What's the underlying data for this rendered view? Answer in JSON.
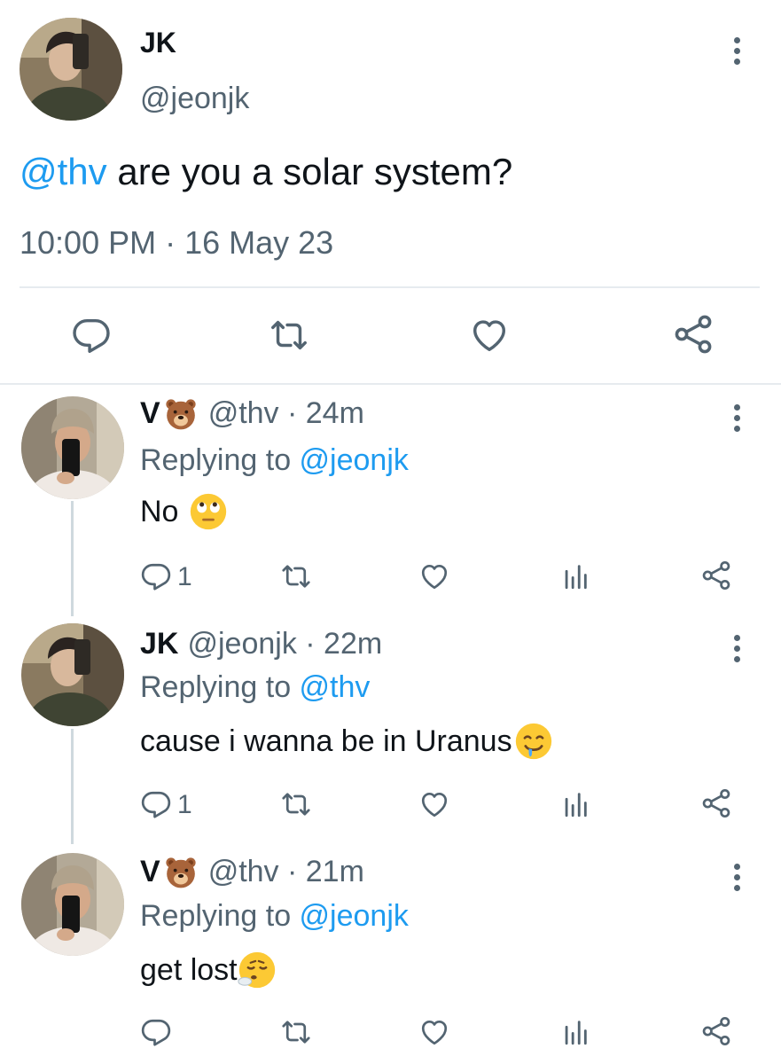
{
  "main_tweet": {
    "name": "JK",
    "handle": "@jeonjk",
    "mention": "@thv",
    "text": " are you a solar system?",
    "time": "10:00 PM · 16 May 23"
  },
  "replies": [
    {
      "name": "V",
      "name_emoji": "bear-face-emoji",
      "handle_time": "@thv · 24m",
      "replying_prefix": "Replying to ",
      "replying_to": "@jeonjk",
      "text": "No",
      "text_emoji": "face-with-rolling-eyes-emoji",
      "reply_count": "1"
    },
    {
      "name": "JK",
      "handle_time": "@jeonjk · 22m",
      "replying_prefix": "Replying to ",
      "replying_to": "@thv",
      "text": "cause i wanna be in Uranus",
      "text_emoji": "drooling-face-emoji",
      "reply_count": "1"
    },
    {
      "name": "V",
      "name_emoji": "bear-face-emoji",
      "handle_time": "@thv · 21m",
      "replying_prefix": "Replying to ",
      "replying_to": "@jeonjk",
      "text": "get lost",
      "text_emoji": "face-exhaling-emoji",
      "reply_count": ""
    }
  ],
  "colors": {
    "accent": "#1d9bf0",
    "secondary_text": "#536471",
    "divider": "#e6ebef"
  }
}
